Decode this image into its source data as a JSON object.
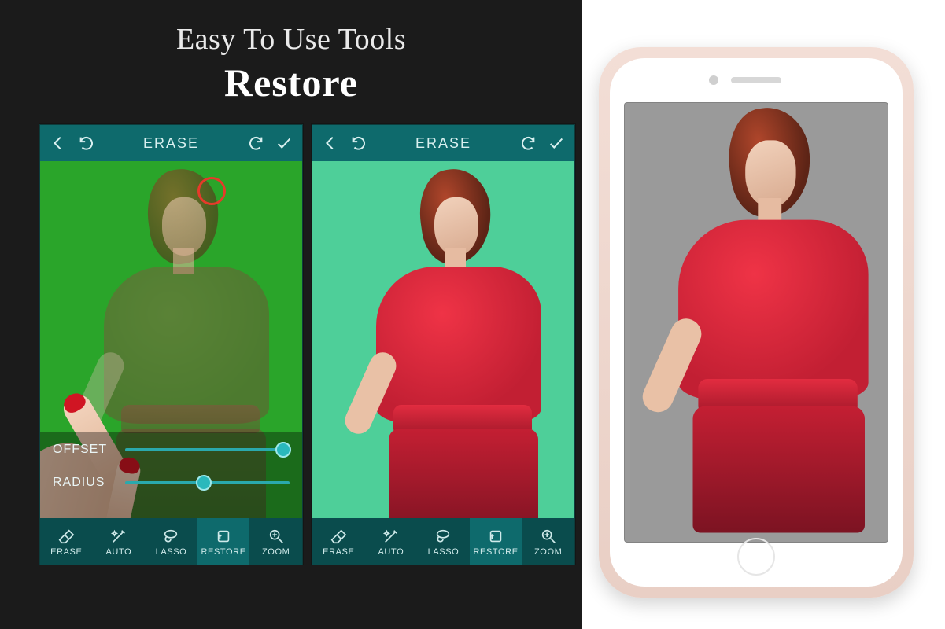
{
  "headline": {
    "line1": "Easy To Use Tools",
    "line2": "Restore"
  },
  "app_title": "ERASE",
  "sliders": {
    "offset": {
      "label": "OFFSET",
      "value_pct": 96
    },
    "radius": {
      "label": "RADIUS",
      "value_pct": 48
    }
  },
  "tools": [
    {
      "key": "erase",
      "label": "ERASE"
    },
    {
      "key": "auto",
      "label": "AUTO"
    },
    {
      "key": "lasso",
      "label": "LASSO"
    },
    {
      "key": "restore",
      "label": "RESTORE"
    },
    {
      "key": "zoom",
      "label": "ZOOM"
    }
  ],
  "active_tool": "restore",
  "colors": {
    "topbar": "#0e6a6c",
    "toolbar": "#0a4c4d",
    "accent": "#2ab8bc",
    "screenshot1_bg": "#2aa52a",
    "screenshot2_bg": "#4ecf99",
    "phone_screen_bg": "#9a9a9a",
    "subject_garment": "#e22c40"
  }
}
